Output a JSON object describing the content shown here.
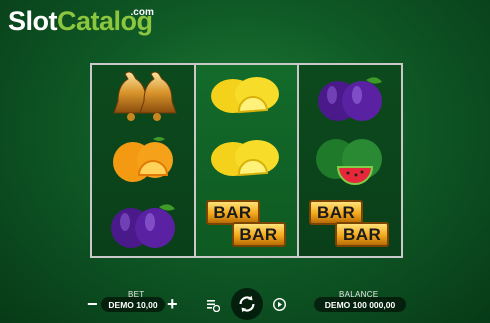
{
  "brand": {
    "part1": "Slot",
    "part2": "Catalog",
    "suffix": ".com"
  },
  "reels": [
    [
      "bells-icon",
      "orange-icon",
      "plum-icon"
    ],
    [
      "lemon-icon",
      "lemon-icon",
      "bar-icon"
    ],
    [
      "plum-icon",
      "watermelon-icon",
      "bar-icon"
    ]
  ],
  "bar_text": "BAR",
  "bet": {
    "label": "BET",
    "value": "DEMO 10,00"
  },
  "balance": {
    "label": "BALANCE",
    "value": "DEMO 100 000,00"
  },
  "colors": {
    "accent": "#8cc63f",
    "background": "#0f5a26",
    "reel_border": "#c9c9c9"
  }
}
